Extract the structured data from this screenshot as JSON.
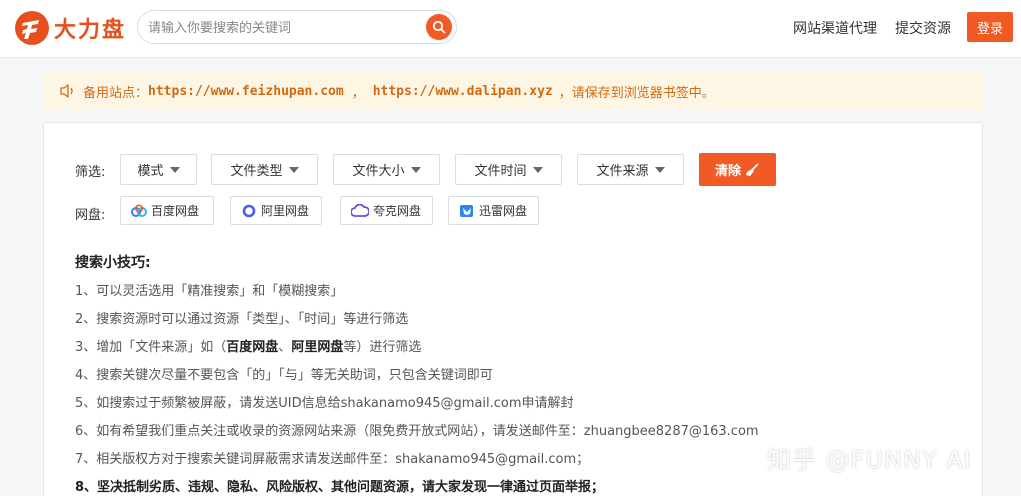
{
  "header": {
    "logo_text": "大力盘",
    "search_placeholder": "请输入你要搜索的关键词",
    "nav": [
      "网站渠道代理",
      "提交资源"
    ],
    "login_label": "登录"
  },
  "notice": {
    "prefix": "备用站点：",
    "url1": "https://www.feizhupan.com",
    "sep": "，",
    "url2": "https://www.dalipan.xyz",
    "suffix": "，请保存到浏览器书签中。"
  },
  "filters": {
    "label": "筛选:",
    "items": [
      "模式",
      "文件类型",
      "文件大小",
      "文件时间",
      "文件来源"
    ],
    "clear_label": "清除"
  },
  "disks": {
    "label": "网盘:",
    "items": [
      "百度网盘",
      "阿里网盘",
      "夸克网盘",
      "迅雷网盘"
    ]
  },
  "tips": {
    "title": "搜索小技巧:",
    "t1": "1、可以灵活选用「精准搜索」和「模糊搜索」",
    "t2": "2、搜索资源时可以通过资源「类型」、「时间」等进行筛选",
    "t3_pre": "3、增加「文件来源」如（",
    "t3_b1": "百度网盘",
    "t3_mid": "、",
    "t3_b2": "阿里网盘",
    "t3_post": "等）进行筛选",
    "t4": "4、搜索关键次尽量不要包含「的」「与」等无关助词，只包含关键词即可",
    "t5": "5、如搜索过于频繁被屏蔽，请发送UID信息给shakanamo945@gmail.com申请解封",
    "t6": "6、如有希望我们重点关注或收录的资源网站来源（限免费开放式网站），请发送邮件至：zhuangbee8287@163.com",
    "t7": "7、相关版权方对于搜索关键词屏蔽需求请发送邮件至：shakanamo945@gmail.com；",
    "t8": "8、坚决抵制劣质、违规、隐私、风险版权、其他问题资源，请大家发现一律通过页面举报；"
  },
  "watermark": "知乎 @FUNNY AI",
  "colors": {
    "accent": "#f15a24",
    "notice_text": "#d36a12",
    "notice_bg": "#fdf6e4"
  }
}
